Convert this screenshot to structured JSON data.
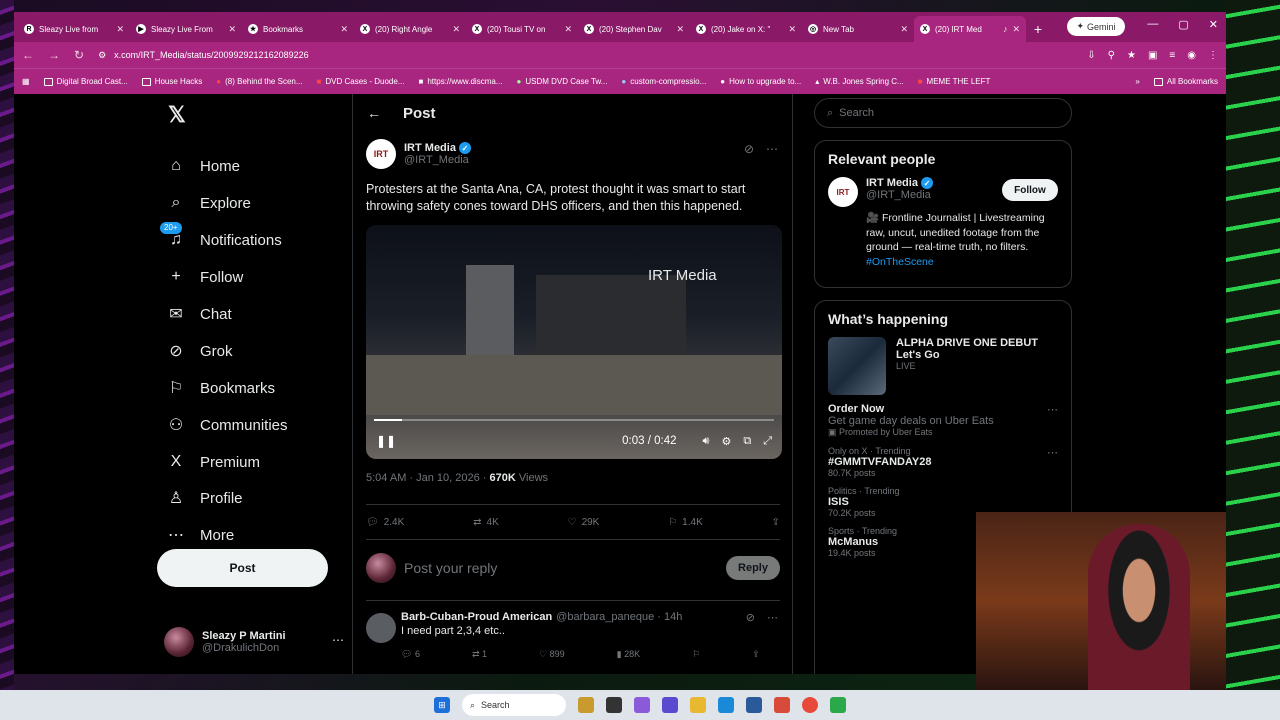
{
  "browser": {
    "tabs": [
      {
        "title": "Sleazy Live from",
        "fav": "R"
      },
      {
        "title": "Sleazy Live From",
        "fav": "▶"
      },
      {
        "title": "Bookmarks",
        "fav": "★"
      },
      {
        "title": "(20) Right Angle",
        "fav": "X"
      },
      {
        "title": "(20) Tousi TV on",
        "fav": "X"
      },
      {
        "title": "(20) Stephen Dav",
        "fav": "X"
      },
      {
        "title": "(20) Jake on X: \"",
        "fav": "X"
      },
      {
        "title": "New Tab",
        "fav": "◎"
      },
      {
        "title": "(20) IRT Med",
        "fav": "X"
      }
    ],
    "gemini_label": "Gemini",
    "url": "x.com/IRT_Media/status/2009929212162089226",
    "bookmarks": [
      "Digital Broad Cast...",
      "House Hacks",
      "(8) Behind the Scen...",
      "DVD Cases - Duode...",
      "https://www.discma...",
      "USDM DVD Case Tw...",
      "custom-compressio...",
      "How to upgrade to...",
      "W.B. Jones Spring C...",
      "MEME THE LEFT"
    ],
    "all_bookmarks": "All Bookmarks"
  },
  "nav": {
    "items": [
      {
        "label": "Home",
        "icon": "⌂"
      },
      {
        "label": "Explore",
        "icon": "⌕"
      },
      {
        "label": "Notifications",
        "icon": "♫"
      },
      {
        "label": "Follow",
        "icon": "+"
      },
      {
        "label": "Chat",
        "icon": "✉"
      },
      {
        "label": "Grok",
        "icon": "⊘"
      },
      {
        "label": "Bookmarks",
        "icon": "⚐"
      },
      {
        "label": "Communities",
        "icon": "⚇"
      },
      {
        "label": "Premium",
        "icon": "X"
      },
      {
        "label": "Profile",
        "icon": "♙"
      },
      {
        "label": "More",
        "icon": "⋯"
      }
    ],
    "notif_badge": "20+",
    "post_label": "Post",
    "me": {
      "name": "Sleazy P Martini",
      "handle": "@DrakulichDon"
    }
  },
  "post": {
    "header_title": "Post",
    "author_name": "IRT Media",
    "author_handle": "@IRT_Media",
    "author_logo": "IRT",
    "text": "Protesters at the Santa Ana, CA, protest thought it was smart to start throwing safety cones toward DHS officers, and then this happened.",
    "video": {
      "watermark": "IRT Media",
      "time": "0:03 / 0:42",
      "progress": 0.07
    },
    "timestamp": "5:04 AM · Jan 10, 2026 · ",
    "views_count": "670K",
    "views_label": " Views",
    "stats": {
      "replies": "2.4K",
      "reposts": "4K",
      "likes": "29K",
      "bookmarks": "1.4K"
    },
    "reply_placeholder": "Post your reply",
    "reply_button": "Reply"
  },
  "comment": {
    "name": "Barb-Cuban-Proud American",
    "handle": "@barbara_paneque · 14h",
    "text": "I need part 2,3,4 etc..",
    "replies": "6",
    "reposts": "1",
    "likes": "899",
    "views": "28K"
  },
  "sidebar": {
    "search_placeholder": "Search",
    "relevant_title": "Relevant people",
    "person": {
      "name": "IRT Media",
      "handle": "@IRT_Media",
      "follow": "Follow",
      "bio": "🎥 Frontline Journalist | Livestreaming raw, uncut, unedited footage from the ground — real-time truth, no filters.",
      "hashtag": "#OnTheScene"
    },
    "happening_title": "What’s happening",
    "event": {
      "title": "ALPHA DRIVE ONE DEBUT Let's Go",
      "status": "LIVE"
    },
    "promo": {
      "title": "Order Now",
      "desc": "Get game day deals on Uber Eats",
      "promoted": "Promoted by Uber Eats"
    },
    "trends": [
      {
        "cat": "Only on X · Trending",
        "name": "#GMMTVFANDAY28",
        "count": "80.7K posts"
      },
      {
        "cat": "Politics · Trending",
        "name": "ISIS",
        "count": "70.2K posts"
      },
      {
        "cat": "Sports · Trending",
        "name": "McManus",
        "count": "19.4K posts"
      }
    ]
  },
  "taskbar": {
    "search": "Search"
  }
}
